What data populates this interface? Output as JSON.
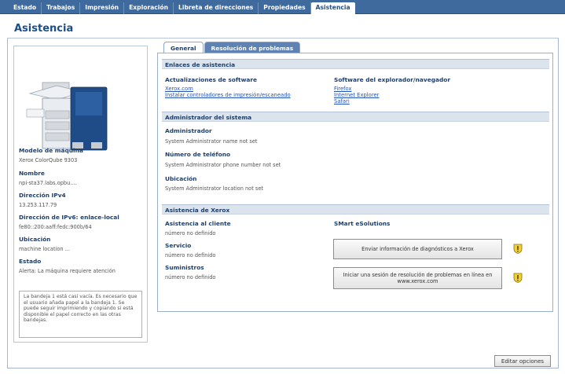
{
  "nav": {
    "tabs": [
      "Estado",
      "Trabajos",
      "Impresión",
      "Exploración",
      "Libreta de direcciones",
      "Propiedades",
      "Asistencia"
    ],
    "active_tab": "Asistencia"
  },
  "page": {
    "title": "Asistencia"
  },
  "left_panel": {
    "model_label": "Modelo de máquina",
    "model_value": "Xerox ColorQube 9303",
    "name_label": "Nombre",
    "name_value": "npi-sta37.labs.opbu....",
    "ipv4_label": "Dirección IPv4",
    "ipv4_value": "13.253.117.79",
    "ipv6_label": "Dirección de IPv6: enlace-local",
    "ipv6_value": "fe80::200:aaff:fedc:900b/64",
    "location_label": "Ubicación",
    "location_value": "machine location ...",
    "status_label": "Estado",
    "status_value": "Alerta: La máquina requiere atención",
    "alert_text": "La bandeja 1 está casi vacía. Es necesario que el usuario añada papel a la bandeja 1. Se puede seguir imprimiendo y copiando si está disponible el papel correcto en las otras bandejas."
  },
  "content_tabs": {
    "general": "General",
    "troubleshooting": "Resolución de problemas"
  },
  "support_links": {
    "header": "Enlaces de asistencia",
    "software_updates_label": "Actualizaciones de software",
    "software_links": [
      "Xerox.com",
      "Instalar controladores de impresión/escaneado"
    ],
    "browser_label": "Software del explorador/navegador",
    "browser_links": [
      "Firefox",
      "Internet Explorer",
      "Safari"
    ]
  },
  "sysadmin": {
    "header": "Administrador del sistema",
    "admin_label": "Administrador",
    "admin_value": "System Administrator name not set",
    "phone_label": "Número de teléfono",
    "phone_value": "System Administrator phone number not set",
    "location_label": "Ubicación",
    "location_value": "System Administrator location not set"
  },
  "xerox_support": {
    "header": "Asistencia de Xerox",
    "customer_label": "Asistencia al cliente",
    "customer_value": "número no definido",
    "service_label": "Servicio",
    "service_value": "número no definido",
    "supplies_label": "Suministros",
    "supplies_value": "número no definido",
    "smart_label": "SMart eSolutions",
    "send_diag_button": "Enviar información de diagnósticos a Xerox",
    "online_troubleshoot_button": "Iniciar una sesión de resolución de problemas en línea en www.xerox.com"
  },
  "footer": {
    "edit_button": "Editar opciones"
  },
  "colors": {
    "nav_bar": "#3f6a9e",
    "title": "#1a4f8a",
    "section_header_bg": "#dbe3ed",
    "link": "#2453b8"
  },
  "icons": {
    "help_icon": "yellow-shield-info-icon"
  }
}
